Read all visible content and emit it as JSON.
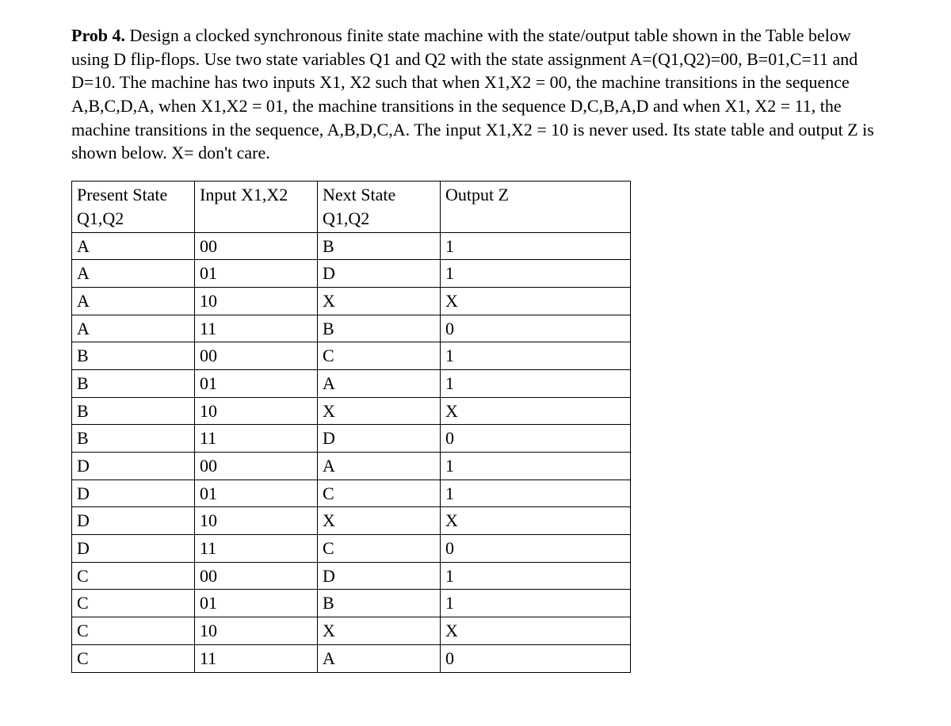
{
  "problem": {
    "label": "Prob 4.",
    "text": " Design  a clocked synchronous finite state machine with the state/output table shown in the Table below using D flip-flops. Use two state variables Q1 and Q2 with the state assignment A=(Q1,Q2)=00, B=01,C=11 and D=10. The machine has two inputs X1, X2 such that when X1,X2 = 00, the machine transitions in the sequence A,B,C,D,A, when X1,X2 = 01, the machine transitions in the sequence D,C,B,A,D and when X1, X2 = 11, the machine transitions in the sequence, A,B,D,C,A. The input X1,X2 = 10 is never used. Its state table and output Z is shown below. X= don't care."
  },
  "table": {
    "headers": {
      "col1_line1": "Present State",
      "col1_line2": "Q1,Q2",
      "col2_line1": "Input X1,X2",
      "col3_line1": "Next State",
      "col3_line2": "Q1,Q2",
      "col4_line1": "Output Z"
    },
    "rows": [
      {
        "ps": "A",
        "in": "00",
        "ns": "B",
        "z": "1"
      },
      {
        "ps": "A",
        "in": "01",
        "ns": "D",
        "z": "1"
      },
      {
        "ps": "A",
        "in": "10",
        "ns": "X",
        "z": "X"
      },
      {
        "ps": "A",
        "in": "11",
        "ns": "B",
        "z": "0"
      },
      {
        "ps": "B",
        "in": "00",
        "ns": "C",
        "z": "1"
      },
      {
        "ps": "B",
        "in": "01",
        "ns": "A",
        "z": "1"
      },
      {
        "ps": "B",
        "in": "10",
        "ns": "X",
        "z": "X"
      },
      {
        "ps": "B",
        "in": "11",
        "ns": "D",
        "z": "0"
      },
      {
        "ps": "D",
        "in": "00",
        "ns": "A",
        "z": "1"
      },
      {
        "ps": "D",
        "in": "01",
        "ns": "C",
        "z": "1"
      },
      {
        "ps": "D",
        "in": "10",
        "ns": "X",
        "z": "X"
      },
      {
        "ps": "D",
        "in": "11",
        "ns": "C",
        "z": "0"
      },
      {
        "ps": "C",
        "in": "00",
        "ns": "D",
        "z": "1"
      },
      {
        "ps": "C",
        "in": "01",
        "ns": "B",
        "z": "1"
      },
      {
        "ps": "C",
        "in": "10",
        "ns": "X",
        "z": "X"
      },
      {
        "ps": "C",
        "in": "11",
        "ns": "A",
        "z": "0"
      }
    ]
  }
}
